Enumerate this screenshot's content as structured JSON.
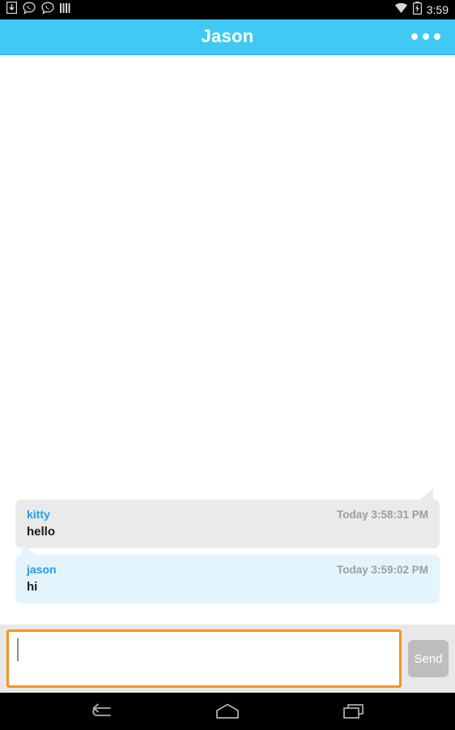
{
  "status_bar": {
    "icons": [
      {
        "name": "download-to-device-icon"
      },
      {
        "name": "chat-call-bubble-icon"
      },
      {
        "name": "chat-call-bubble-icon-2"
      },
      {
        "name": "signal-bars-icon"
      }
    ],
    "wifi_icon": "wifi-icon",
    "battery_icon": "battery-charging-icon",
    "time": "3:59"
  },
  "header": {
    "title": "Jason",
    "overflow_label": "overflow-menu",
    "background_color": "#41c9f5",
    "title_color": "#ffffff"
  },
  "messages": [
    {
      "sender": "kitty",
      "timestamp": "Today 3:58:31 PM",
      "text": "hello",
      "side": "them",
      "bubble_color": "#eaeaea"
    },
    {
      "sender": "jason",
      "timestamp": "Today 3:59:02 PM",
      "text": "hi",
      "side": "me",
      "bubble_color": "#e4f4fd"
    }
  ],
  "composer": {
    "input_value": "",
    "input_placeholder": "",
    "focus_border_color": "#f7931e",
    "send_label": "Send",
    "send_color": "#bdbdbd"
  },
  "nav_bar": {
    "back_label": "back-button",
    "home_label": "home-button",
    "recents_label": "recents-button"
  },
  "colors": {
    "accent": "#41c9f5",
    "sender_name": "#1e9fe8",
    "timestamp": "#9e9e9e",
    "focus": "#f7931e"
  }
}
